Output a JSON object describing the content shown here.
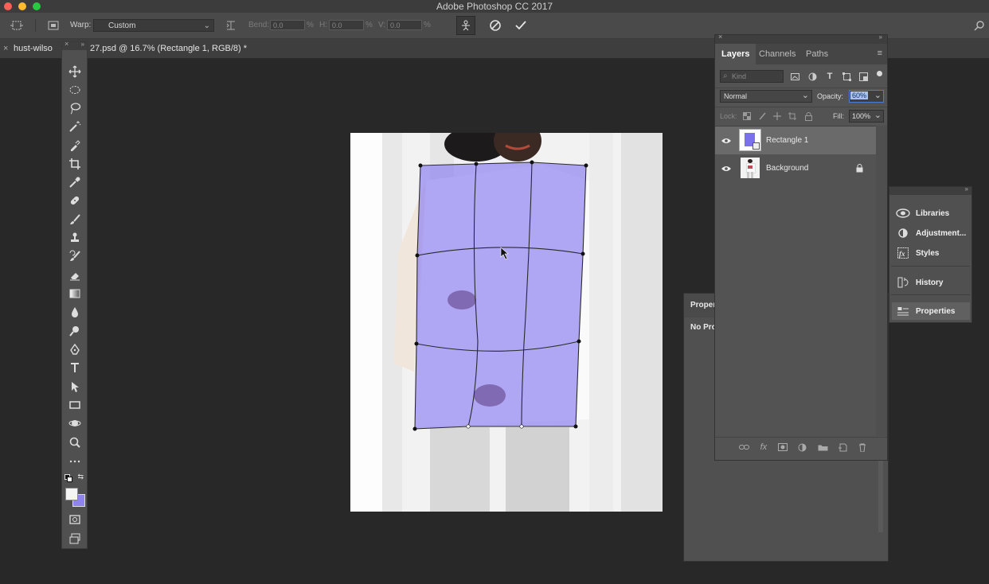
{
  "app": {
    "title": "Adobe Photoshop CC 2017",
    "traffic": {
      "close": "#fe5f57",
      "minimize": "#febb2e",
      "zoom": "#28c840"
    }
  },
  "options_bar": {
    "warp_label": "Warp:",
    "warp_value": "Custom",
    "bend_label": "Bend:",
    "bend_value": "0.0",
    "h_label": "H:",
    "h_value": "0.0",
    "v_label": "V:",
    "v_value": "0.0",
    "percent": "%",
    "icons": [
      "move-icon",
      "warp-mode-icon",
      "warp-orientation-icon",
      "puppet-icon",
      "cancel-icon",
      "commit-icon",
      "search-icon"
    ]
  },
  "document": {
    "tab_prefix": "hust-wilso",
    "tab_suffix": "27.psd @ 16.7% (Rectangle 1, RGB/8) *",
    "close": "×"
  },
  "toolbar": {
    "tools": [
      "move-tool",
      "elliptical-marquee-tool",
      "lasso-tool",
      "magic-wand-tool",
      "brush-select-tool",
      "crop-tool",
      "eyedropper-tool",
      "healing-brush-tool",
      "brush-tool",
      "clone-stamp-tool",
      "history-brush-tool",
      "eraser-tool",
      "gradient-tool",
      "blur-tool",
      "dodge-tool",
      "pen-tool",
      "type-tool",
      "path-selection-tool",
      "rectangle-tool",
      "3d-rotate-tool",
      "zoom-tool",
      "more-tools",
      "default-colors",
      "foreground-color",
      "quick-mask",
      "screen-mode"
    ],
    "foreground_color": "#f4f4f4",
    "background_color": "#8f84ec"
  },
  "layers_panel": {
    "tabs": [
      "Layers",
      "Channels",
      "Paths"
    ],
    "active_tab": "Layers",
    "filter_placeholder": "Kind",
    "blend_mode": "Normal",
    "opacity_label": "Opacity:",
    "opacity_value": "60%",
    "lock_label": "Lock:",
    "fill_label": "Fill:",
    "fill_value": "100%",
    "layers": [
      {
        "name": "Rectangle 1",
        "visible": true,
        "selected": true
      },
      {
        "name": "Background",
        "visible": true,
        "locked": true
      }
    ]
  },
  "dock": {
    "items": [
      "Libraries",
      "Adjustment...",
      "Styles",
      "History",
      "Properties"
    ],
    "active": "Properties"
  },
  "properties_panel": {
    "title": "Proper",
    "body": "No Pro"
  },
  "warp": {
    "overlay_color": "#8a7ff0"
  }
}
